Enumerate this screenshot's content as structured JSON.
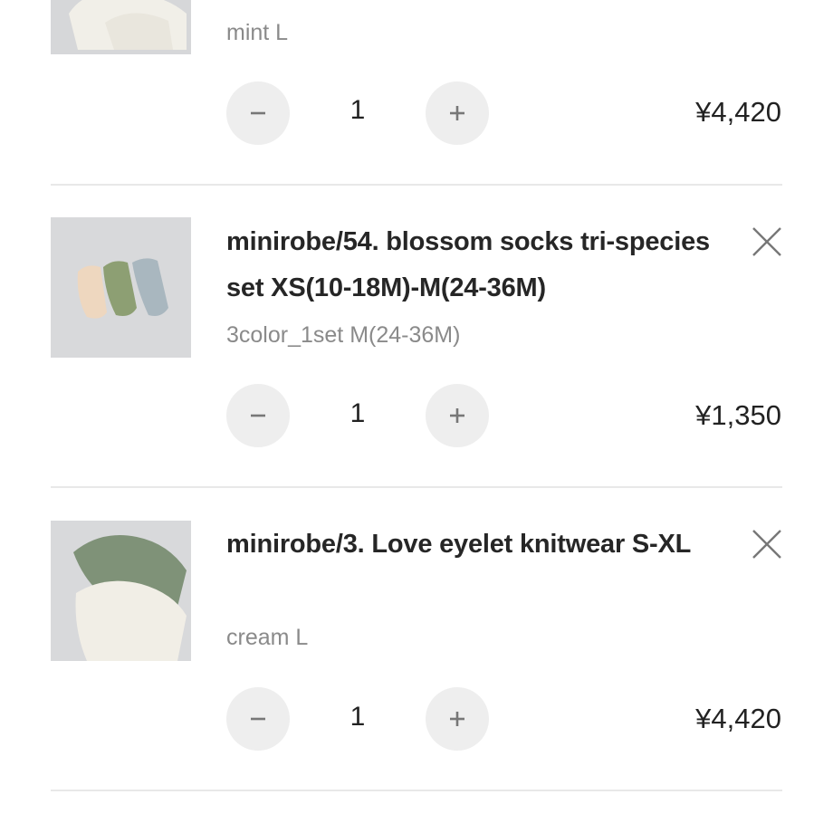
{
  "cart": {
    "items": [
      {
        "title": "",
        "variant": "mint L",
        "quantity": "1",
        "price": "¥4,420",
        "image_icon": "sweater-product-image"
      },
      {
        "title": "minirobe/54. blossom socks tri-species set XS(10-18M)-M(24-36M)",
        "variant": "3color_1set M(24-36M)",
        "quantity": "1",
        "price": "¥1,350",
        "image_icon": "socks-product-image"
      },
      {
        "title": "minirobe/3. Love eyelet knitwear S-XL",
        "variant": "cream L",
        "quantity": "1",
        "price": "¥4,420",
        "image_icon": "knitwear-product-image"
      }
    ]
  },
  "icons": {
    "remove": "close-icon",
    "decrease": "minus-icon",
    "increase": "plus-icon"
  },
  "colors": {
    "button_bg": "#eeeeee",
    "icon": "#777777",
    "variant_text": "#8a8a8a",
    "divider": "#e8e8e8"
  }
}
